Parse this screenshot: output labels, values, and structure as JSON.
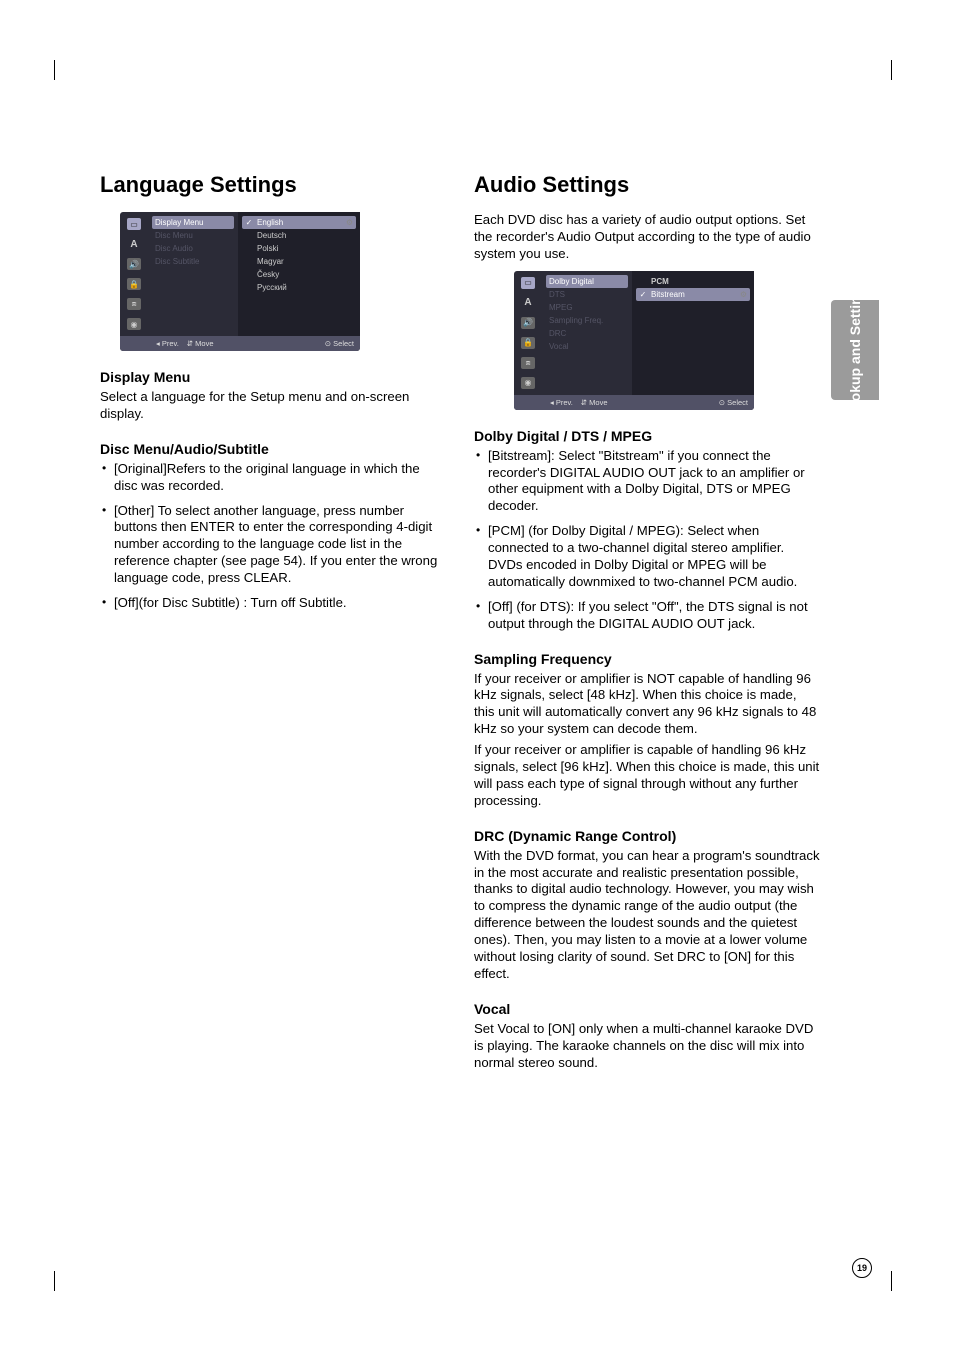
{
  "sideTab": "Hookup and Settings",
  "pageNumber": "19",
  "left": {
    "heading": "Language Settings",
    "osd": {
      "menu": [
        {
          "label": "Display Menu",
          "sel": true
        },
        {
          "label": "Disc Menu",
          "sel": false
        },
        {
          "label": "Disc Audio",
          "sel": false
        },
        {
          "label": "Disc Subtitle",
          "sel": false
        }
      ],
      "values": [
        {
          "label": "English",
          "sel": true,
          "check": true,
          "gear": true
        },
        {
          "label": "Deutsch"
        },
        {
          "label": "Polski"
        },
        {
          "label": "Magyar"
        },
        {
          "label": "Česky"
        },
        {
          "label": "Русский"
        }
      ],
      "footer": {
        "prev": "◂ Prev.",
        "move": "⇵ Move",
        "select": "⊙ Select"
      }
    },
    "sec1": {
      "title": "Display Menu",
      "p1": "Select a language for the Setup menu and on-screen display."
    },
    "sec2": {
      "title": "Disc Menu/Audio/Subtitle",
      "b1": "[Original]Refers to the original language in which the disc was recorded.",
      "b2": "[Other] To select another language, press number buttons then ENTER to enter the corresponding 4-digit number according to the language code list in the reference chapter (see page 54). If you enter the wrong language code, press CLEAR.",
      "b3": "[Off](for Disc Subtitle) : Turn off Subtitle."
    }
  },
  "right": {
    "heading": "Audio Settings",
    "intro": "Each DVD disc has a variety of audio output options. Set the recorder's Audio Output according to the type of audio system you use.",
    "osd": {
      "menu": [
        {
          "label": "Dolby Digital",
          "sel": true
        },
        {
          "label": "DTS",
          "sel": false
        },
        {
          "label": "MPEG",
          "sel": false
        },
        {
          "label": "Sampling Freq.",
          "sel": false
        },
        {
          "label": "DRC",
          "sel": false
        },
        {
          "label": "Vocal",
          "sel": false
        }
      ],
      "values": [
        {
          "label": "PCM",
          "header": true
        },
        {
          "label": "Bitstream",
          "sel": true,
          "check": true,
          "gear": true
        }
      ],
      "footer": {
        "prev": "◂ Prev.",
        "move": "⇵ Move",
        "select": "⊙ Select"
      }
    },
    "sec1": {
      "title": "Dolby Digital / DTS / MPEG",
      "b1": "[Bitstream]: Select \"Bitstream\" if you connect the recorder's DIGITAL AUDIO OUT jack to an amplifier or other equipment with a Dolby Digital, DTS or MPEG decoder.",
      "b2": "[PCM] (for Dolby Digital / MPEG): Select when connected to a two-channel digital stereo amplifier. DVDs encoded in Dolby Digital or MPEG will be automatically downmixed to two-channel PCM audio.",
      "b3": "[Off] (for DTS): If you select \"Off\", the DTS signal is not output through the DIGITAL AUDIO OUT jack."
    },
    "sec2": {
      "title": "Sampling Frequency",
      "p1": "If your receiver or amplifier is NOT capable of handling 96 kHz signals, select [48 kHz]. When this choice is made, this unit will automatically convert any 96 kHz signals to 48 kHz so your system can decode them.",
      "p2": "If your receiver or amplifier is capable of handling 96 kHz signals, select [96 kHz]. When this choice is made, this unit will pass each type of signal through without any further processing."
    },
    "sec3": {
      "title": "DRC (Dynamic Range Control)",
      "p1": "With the DVD format, you can hear a program's soundtrack in the most accurate and realistic presentation possible, thanks to digital audio technology. However, you may wish to compress the dynamic range of the audio output (the difference between the loudest sounds and the quietest ones). Then, you may listen to a movie at a lower volume without losing clarity of sound. Set DRC to [ON] for this effect."
    },
    "sec4": {
      "title": "Vocal",
      "p1": "Set Vocal to [ON] only when a multi-channel karaoke DVD is playing. The karaoke channels on the disc will mix into normal stereo sound."
    }
  }
}
